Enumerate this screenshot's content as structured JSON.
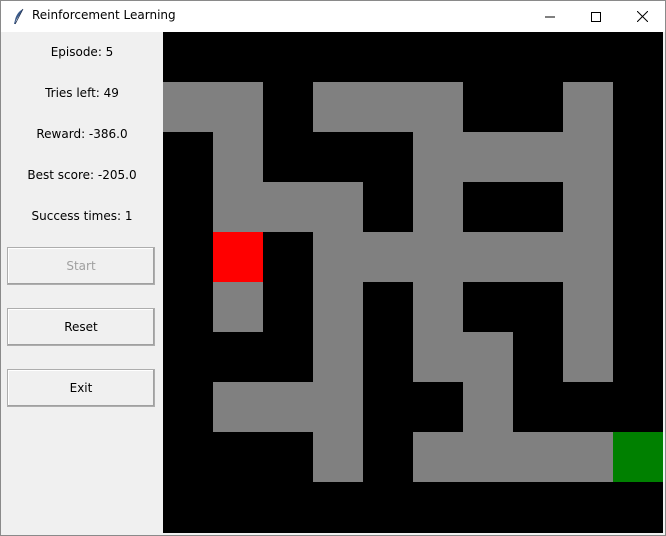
{
  "window": {
    "title": "Reinforcement Learning",
    "icon": "feather-icon",
    "controls": [
      "minimize-icon",
      "maximize-icon",
      "close-icon"
    ]
  },
  "stats": {
    "episode": "Episode: 5",
    "tries_left": "Tries left: 49",
    "reward": "Reward: -386.0",
    "best_score": "Best score: -205.0",
    "success_times": "Success times: 1"
  },
  "buttons": {
    "start": {
      "label": "Start",
      "enabled": false
    },
    "reset": {
      "label": "Reset",
      "enabled": true
    },
    "exit": {
      "label": "Exit",
      "enabled": true
    }
  },
  "maze": {
    "grid_size": [
      10,
      10
    ],
    "colors": {
      "wall": "#000000",
      "path": "#808080",
      "agent": "#ff0000",
      "goal": "#008000"
    },
    "path_cells": [
      [
        1,
        0
      ],
      [
        1,
        1
      ],
      [
        1,
        3
      ],
      [
        1,
        4
      ],
      [
        1,
        5
      ],
      [
        1,
        8
      ],
      [
        2,
        1
      ],
      [
        2,
        5
      ],
      [
        2,
        6
      ],
      [
        2,
        7
      ],
      [
        2,
        8
      ],
      [
        3,
        1
      ],
      [
        3,
        2
      ],
      [
        3,
        3
      ],
      [
        3,
        5
      ],
      [
        3,
        8
      ],
      [
        4,
        3
      ],
      [
        4,
        4
      ],
      [
        4,
        5
      ],
      [
        4,
        6
      ],
      [
        4,
        7
      ],
      [
        4,
        8
      ],
      [
        5,
        1
      ],
      [
        5,
        3
      ],
      [
        5,
        5
      ],
      [
        5,
        8
      ],
      [
        6,
        3
      ],
      [
        6,
        5
      ],
      [
        6,
        6
      ],
      [
        6,
        8
      ],
      [
        7,
        1
      ],
      [
        7,
        2
      ],
      [
        7,
        3
      ],
      [
        7,
        6
      ],
      [
        8,
        3
      ],
      [
        8,
        5
      ],
      [
        8,
        6
      ],
      [
        8,
        7
      ],
      [
        8,
        8
      ]
    ],
    "agent": [
      4,
      1
    ],
    "goal": [
      8,
      9
    ]
  }
}
